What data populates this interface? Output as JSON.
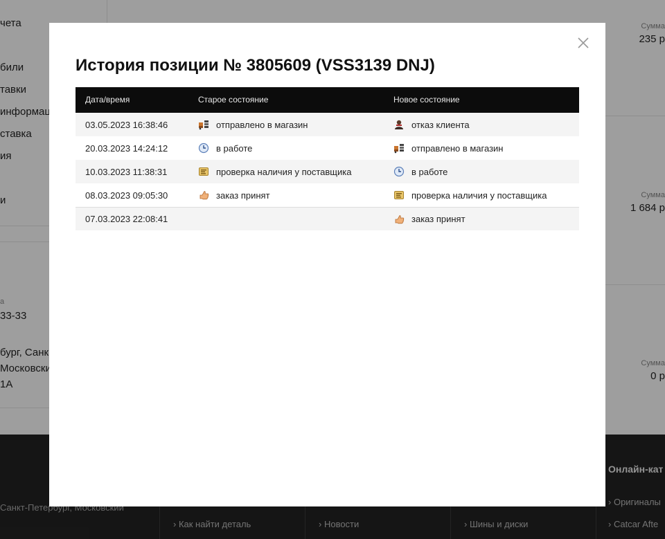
{
  "background": {
    "nav": [
      "чета",
      "били",
      "тавки",
      "информац",
      "ставка",
      "ия",
      "и"
    ],
    "contact": {
      "label_fragment": "а",
      "phone_fragment": "33-33",
      "address_lines": [
        "бург, Санк",
        "Московски",
        "1А"
      ]
    },
    "summaries": [
      {
        "label": "Сумма",
        "value": "235 р"
      },
      {
        "label": "Сумма",
        "value": "1 684 р"
      },
      {
        "label": "Сумма",
        "value": "0 р"
      }
    ],
    "footer": {
      "address": "Санкт-Петербург, Московский",
      "links": [
        "Как найти деталь",
        "Новости",
        "Шины и диски"
      ],
      "right_title": "Онлайн-кат",
      "right_links": [
        "Оригиналы",
        "Catcar Afte"
      ]
    }
  },
  "modal": {
    "title": "История позиции № 3805609 (VSS3139 DNJ)",
    "close_icon": "close-icon",
    "columns": {
      "datetime": "Дата/время",
      "old_state": "Старое состояние",
      "new_state": "Новое состояние"
    },
    "rows": [
      {
        "datetime": "03.05.2023 16:38:46",
        "old": {
          "icon": "shipped-icon",
          "text": "отправлено в магазин"
        },
        "new": {
          "icon": "client-refusal-icon",
          "text": "отказ клиента"
        }
      },
      {
        "datetime": "20.03.2023 14:24:12",
        "old": {
          "icon": "clock-icon",
          "text": "в работе"
        },
        "new": {
          "icon": "shipped-icon",
          "text": "отправлено в магазин"
        }
      },
      {
        "datetime": "10.03.2023 11:38:31",
        "old": {
          "icon": "supplier-check-icon",
          "text": "проверка наличия у поставщика"
        },
        "new": {
          "icon": "clock-icon",
          "text": "в работе"
        }
      },
      {
        "datetime": "08.03.2023 09:05:30",
        "old": {
          "icon": "order-accepted-icon",
          "text": "заказ принят"
        },
        "new": {
          "icon": "supplier-check-icon",
          "text": "проверка наличия у поставщика"
        }
      },
      {
        "datetime": "07.03.2023 22:08:41",
        "old": {
          "icon": "",
          "text": ""
        },
        "new": {
          "icon": "order-accepted-icon",
          "text": "заказ принят"
        }
      }
    ]
  },
  "colors": {
    "overlay": "#000000",
    "header_bg": "#0c0c0c",
    "stripe": "#f4f4f4",
    "footer_bg": "#232323"
  }
}
